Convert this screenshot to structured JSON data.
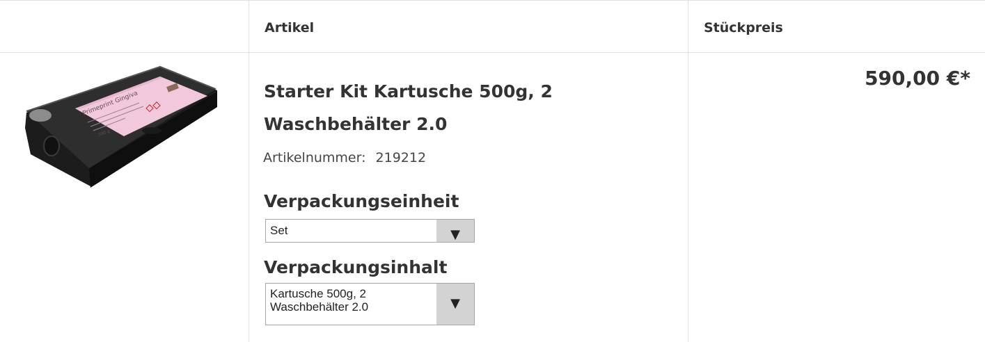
{
  "table": {
    "headers": {
      "article": "Artikel",
      "unit_price": "Stückpreis"
    }
  },
  "product": {
    "image_icon": "product-cartridge-image",
    "label_text": "Primeprint Gingiva",
    "label_weight": "500 g",
    "title": "Starter Kit Kartusche 500g, 2 Waschbehälter 2.0",
    "article_number_label": "Artikelnummer:",
    "article_number": "219212",
    "packaging_unit": {
      "label": "Verpackungseinheit",
      "selected": "Set",
      "arrow_icon": "triangle-down-icon"
    },
    "packaging_content": {
      "label": "Verpackungsinhalt",
      "selected_line1": "Kartusche 500g, 2",
      "selected_line2": "Waschbehälter 2.0",
      "arrow_icon": "triangle-down-icon"
    },
    "price": "590,00 €*"
  },
  "colors": {
    "text": "#333333",
    "border": "#e2e2e2",
    "select_button": "#d3d3d3",
    "label_pink": "#f2c9dc"
  }
}
